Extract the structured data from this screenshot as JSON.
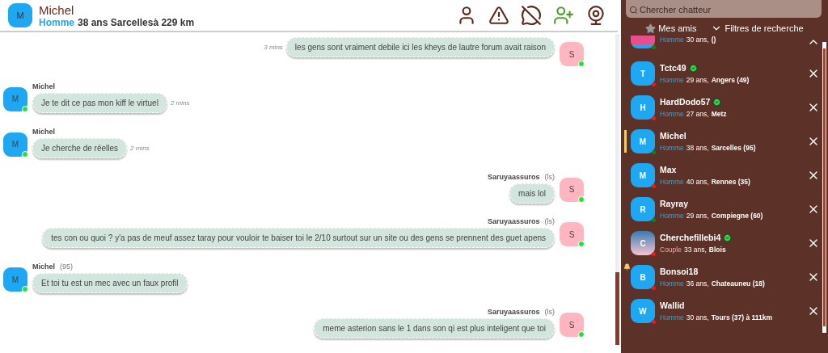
{
  "header": {
    "avatar_letter": "M",
    "name": "Michel",
    "gender": "Homme",
    "details": "38 ans Sarcellesà 229 km"
  },
  "messages": [
    {
      "kind": "outgoing",
      "avatar_letter": "S",
      "online": true,
      "text": "les gens sont vraiment debile ici les kheys de lautre forum avait raison",
      "time": "3 mins"
    },
    {
      "kind": "incoming",
      "avatar_letter": "M",
      "online": true,
      "author": "Michel",
      "text": "Je te dit ce pas mon kiff le virtuel",
      "time": "2 mins"
    },
    {
      "kind": "incoming",
      "avatar_letter": "M",
      "online": true,
      "author": "Michel",
      "text": "Je cherche de réelles",
      "time": "2 mins"
    },
    {
      "kind": "outgoing",
      "avatar_letter": "S",
      "online": true,
      "author": "Saruyaassuros",
      "tag": "(ls)",
      "text": "mais lol"
    },
    {
      "kind": "outgoing",
      "avatar_letter": "S",
      "online": true,
      "author": "Saruyaassuros",
      "tag": "(ls)",
      "text": "tes con ou quoi ? y'a pas de meuf assez taray pour vouloir te baiser toi le 2/10 surtout sur un site ou des gens se prennent des  guet apens"
    },
    {
      "kind": "incoming",
      "avatar_letter": "M",
      "online": true,
      "author": "Michel",
      "tag": "(95)",
      "text": "Et toi tu est un mec avec un faux profil"
    },
    {
      "kind": "outgoing",
      "avatar_letter": "S",
      "online": true,
      "author": "Saruyaassuros",
      "tag": "(ls)",
      "text": "meme asterion sans le 1 dans son qi est plus inteligent que toi"
    }
  ],
  "sidebar": {
    "search": {
      "placeholder": "Chercher chatteur"
    },
    "friends_label": "Mes amis",
    "filters_label": "Filtres de recherche",
    "contacts": [
      {
        "kind": "cut",
        "verified": false,
        "color": "#1e7a1e",
        "gender": "Homme",
        "age": "30 ans,",
        "city": "()",
        "selected": false,
        "expanded": true,
        "bell": false
      },
      {
        "kind": "letter",
        "avatar_letter": "T",
        "name": "Tctc49",
        "verified": true,
        "color": "#e81c1c",
        "gender": "Homme",
        "age": "29 ans,",
        "city": "Angers (49)",
        "selected": false,
        "expanded": false,
        "bell": false
      },
      {
        "kind": "letter",
        "avatar_letter": "H",
        "name": "HardDodo57",
        "verified": true,
        "color": "#e81c1c",
        "gender": "Homme",
        "age": "27 ans,",
        "city": "Metz",
        "selected": false,
        "expanded": false,
        "bell": false
      },
      {
        "kind": "letter",
        "avatar_letter": "M",
        "name": "Michel",
        "verified": false,
        "color": "#1e7a1e",
        "gender": "Homme",
        "age": "38 ans,",
        "city": "Sarcelles (95)",
        "selected": true,
        "expanded": false,
        "bell": false
      },
      {
        "kind": "letter",
        "avatar_letter": "M",
        "name": "Max",
        "verified": false,
        "color": "#e81c1c",
        "gender": "Homme",
        "age": "40 ans,",
        "city": "Rennes (35)",
        "selected": false,
        "expanded": false,
        "bell": false
      },
      {
        "kind": "letter",
        "avatar_letter": "R",
        "name": "Rayray",
        "verified": false,
        "color": "#1e7a1e",
        "gender": "Homme",
        "age": "29 ans,",
        "city": "Compiegne (60)",
        "selected": false,
        "expanded": false,
        "bell": false
      },
      {
        "kind": "photo",
        "avatar_letter": "C",
        "name": "Cherchefillebi4",
        "verified": true,
        "color": "#e81c1c",
        "gender": "Couple",
        "age": "33 ans,",
        "city": "Blois",
        "selected": false,
        "expanded": false,
        "bell": false
      },
      {
        "kind": "letter",
        "avatar_letter": "B",
        "name": "Bonsoi18",
        "verified": false,
        "color": "#e81c1c",
        "gender": "Homme",
        "age": "36 ans,",
        "city": "Chateauneu (18)",
        "selected": false,
        "expanded": false,
        "bell": true
      },
      {
        "kind": "letter",
        "avatar_letter": "W",
        "name": "Wallid",
        "verified": false,
        "color": "#e81c1c",
        "gender": "Homme",
        "age": "30 ans,",
        "city": "Tours (37) à 111km",
        "selected": false,
        "expanded": false,
        "bell": false
      }
    ]
  }
}
